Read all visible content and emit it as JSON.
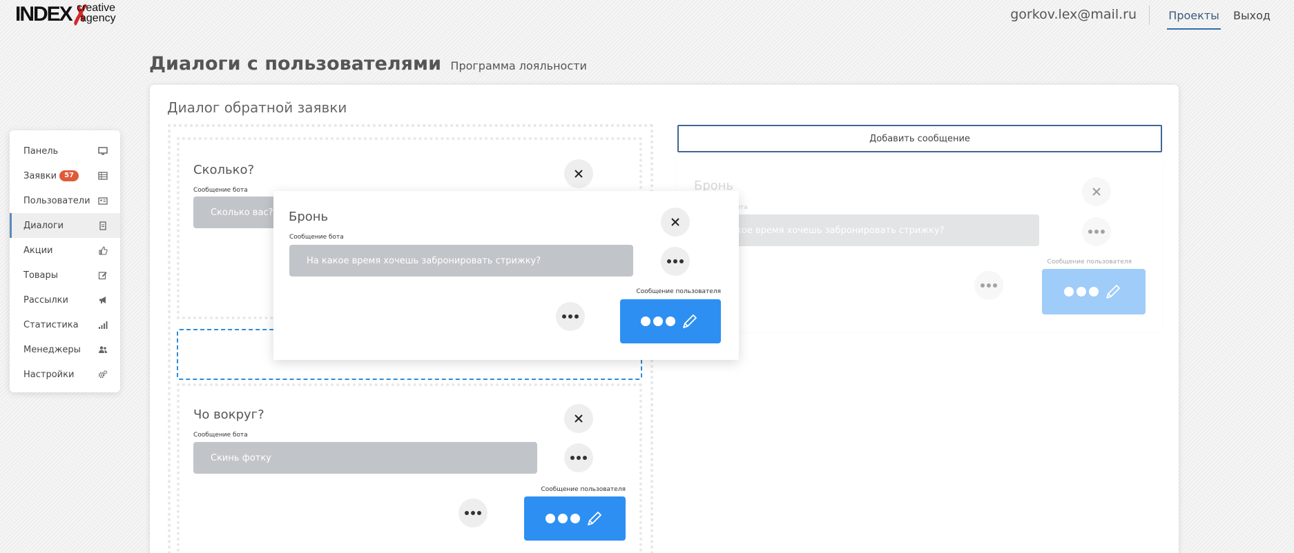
{
  "header": {
    "logo": {
      "main": "INDEX",
      "creative": "creative",
      "agency": "agency"
    },
    "user_email": "gorkov.lex@mail.ru",
    "nav": {
      "projects": "Проекты",
      "exit": "Выход"
    }
  },
  "page": {
    "title": "Диалоги с пользователями",
    "subtitle": "Программа лояльности",
    "dialog_title": "Диалог обратной заявки"
  },
  "sidebar": {
    "items": [
      {
        "label": "Панель",
        "icon": "monitor-icon"
      },
      {
        "label": "Заявки",
        "icon": "table-icon",
        "badge": "57"
      },
      {
        "label": "Пользователи",
        "icon": "id-card-icon"
      },
      {
        "label": "Диалоги",
        "icon": "clipboard-icon",
        "active": true
      },
      {
        "label": "Акции",
        "icon": "thumbs-up-icon"
      },
      {
        "label": "Товары",
        "icon": "edit-icon"
      },
      {
        "label": "Рассылки",
        "icon": "megaphone-icon"
      },
      {
        "label": "Статистика",
        "icon": "signal-icon"
      },
      {
        "label": "Менеджеры",
        "icon": "users-icon"
      },
      {
        "label": "Настройки",
        "icon": "cogs-icon"
      }
    ]
  },
  "labels": {
    "bot_message": "Сообщение бота",
    "user_message": "Сообщение пользователя",
    "bot_message_partial": "бота"
  },
  "messages": {
    "card1": {
      "title": "Сколько?",
      "bot_text": "Сколько вас?"
    },
    "card2": {
      "title": "Чо вокруг?",
      "bot_text": "Скинь фотку"
    },
    "dragging": {
      "title": "Бронь",
      "bot_text": "На какое время хочешь забронировать стрижку?"
    },
    "ghost": {
      "title": "Бронь",
      "bot_text": "кое время хочешь забронировать стрижку?"
    }
  },
  "actions": {
    "add_message": "Добавить сообщение"
  },
  "colors": {
    "accent_blue": "#2d8ff2",
    "badge_red": "#e05a3a",
    "bot_bubble": "#c1c4c8",
    "nav_underline": "#2e6dad"
  }
}
